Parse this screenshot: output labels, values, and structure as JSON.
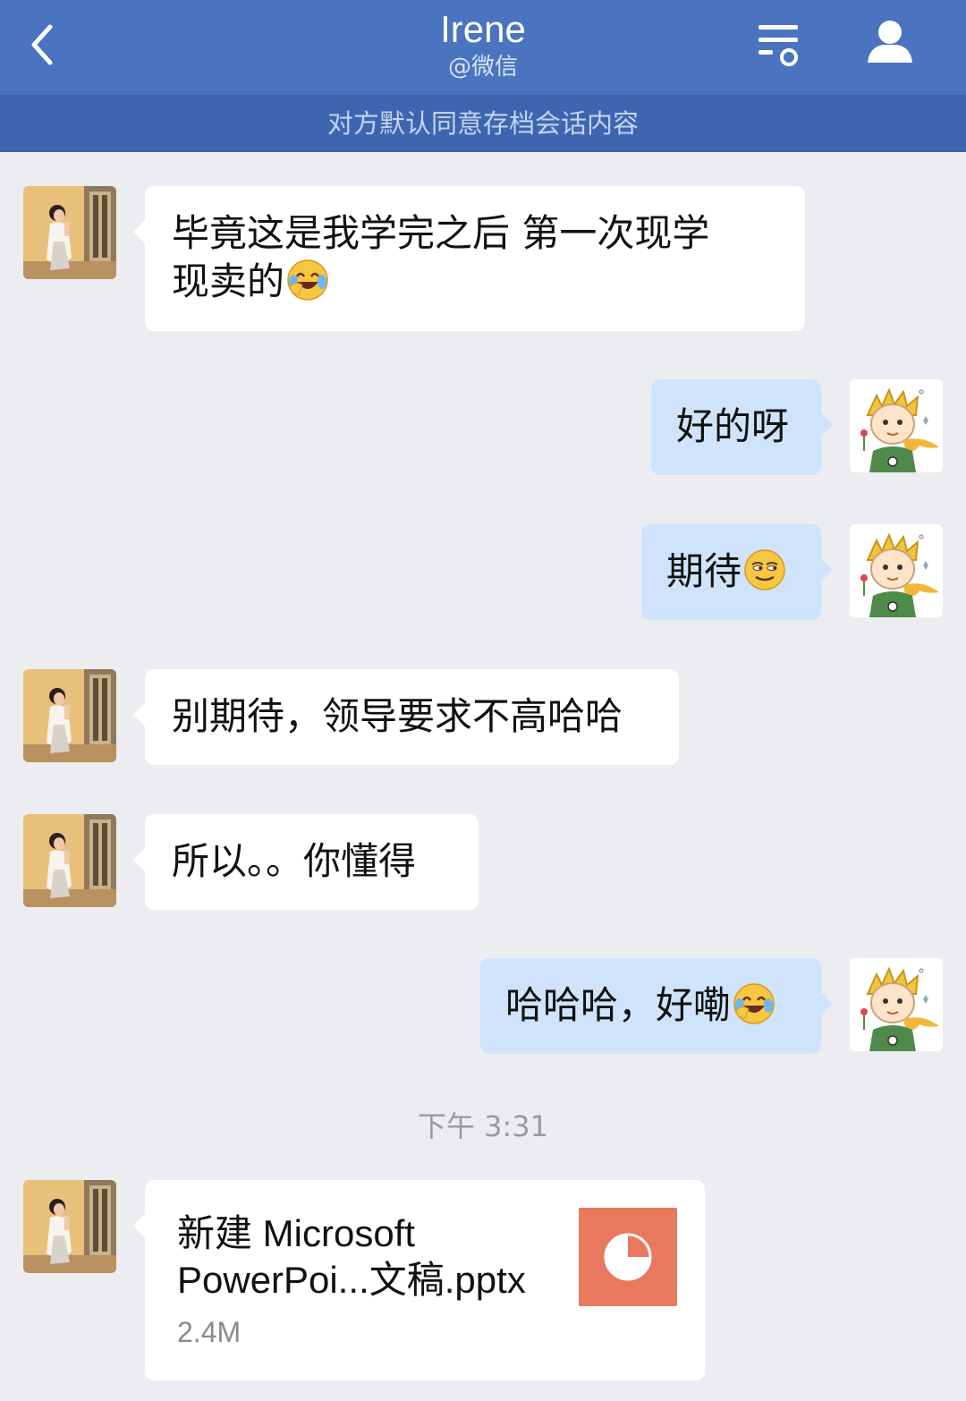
{
  "header": {
    "title": "Irene",
    "subtitle": "@微信",
    "back_icon": "chevron-left-icon",
    "menu_icon": "chat-settings-icon",
    "profile_icon": "person-icon"
  },
  "notice": "对方默认同意存档会话内容",
  "messages": [
    {
      "from": "contact",
      "text_line1": "毕竟这是我学完之后 第一次现学",
      "text_line2": "现卖的",
      "emoji": "laughing-crying-emoji"
    },
    {
      "from": "me",
      "text": "好的呀"
    },
    {
      "from": "me",
      "text": "期待",
      "emoji": "smirk-emoji"
    },
    {
      "from": "contact",
      "text": "别期待，领导要求不高哈哈"
    },
    {
      "from": "contact",
      "text": "所以。。你懂得"
    },
    {
      "from": "me",
      "text": "哈哈哈，好嘞",
      "emoji": "laughing-crying-emoji"
    }
  ],
  "timestamp": "下午 3:31",
  "file_message": {
    "name_line1": "新建 Microsoft",
    "name_line2": "PowerPoi...文稿.pptx",
    "size": "2.4M",
    "icon": "pptx-pie-chart-icon",
    "icon_color": "#e8795e"
  },
  "colors": {
    "header_bg": "#4a74c0",
    "notice_bg": "#3d65b0",
    "incoming_bubble": "#ffffff",
    "outgoing_bubble": "#cfe4fb",
    "chat_bg": "#ebedf0"
  }
}
